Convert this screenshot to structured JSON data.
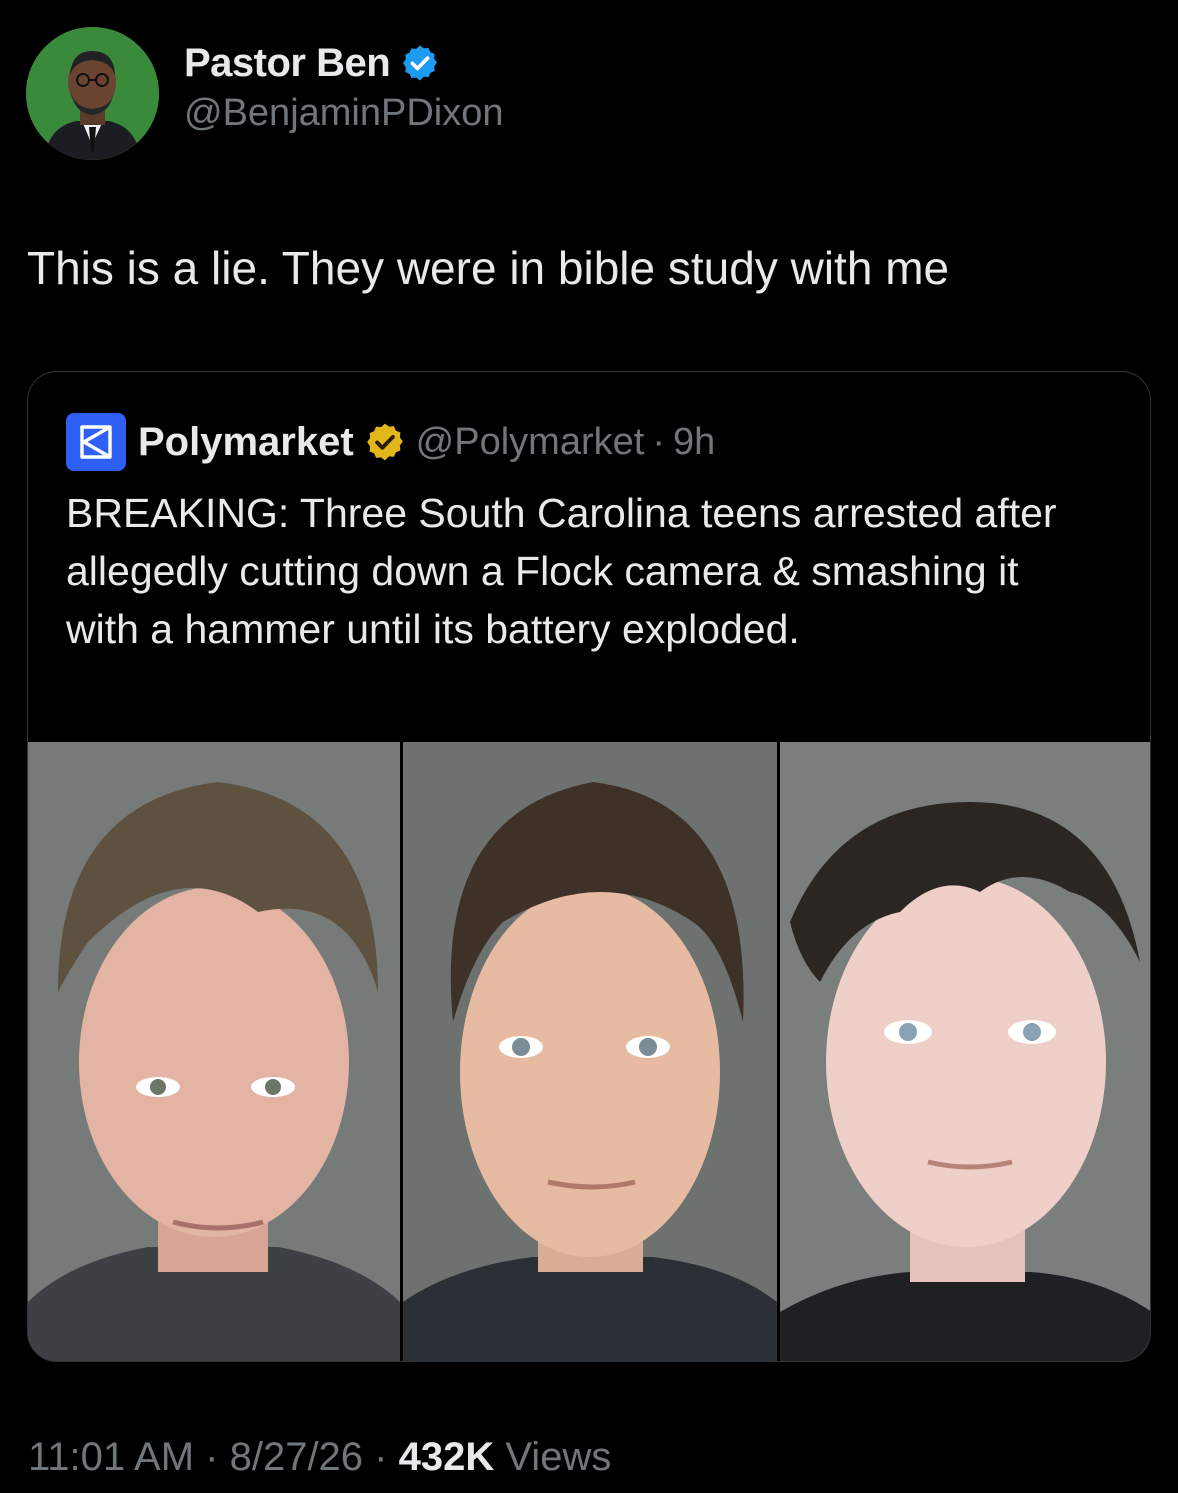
{
  "author": {
    "display_name": "Pastor Ben",
    "handle": "@BenjaminPDixon",
    "verified_icon": "verified-badge-icon",
    "verified_color": "#1d9bf0",
    "avatar_bg": "#3a8a3c"
  },
  "tweet": {
    "text": "This is a lie. They were in bible study with me"
  },
  "quote": {
    "display_name": "Polymarket",
    "handle": "@Polymarket",
    "separator": "·",
    "time": "9h",
    "logo_color": "#2f5ff5",
    "badge_color": "#e2b719",
    "text": "BREAKING: Three South Carolina teens arrested after allegedly cutting down a Flock camera & smashing it with a hammer until its battery exploded.",
    "media": [
      {
        "alt": "mugshot-1"
      },
      {
        "alt": "mugshot-2"
      },
      {
        "alt": "mugshot-3"
      }
    ]
  },
  "footer": {
    "time": "11:01 AM",
    "sep1": " · ",
    "date": "8/27/26",
    "sep2": " · ",
    "views_count": "432K",
    "views_label": " Views"
  }
}
